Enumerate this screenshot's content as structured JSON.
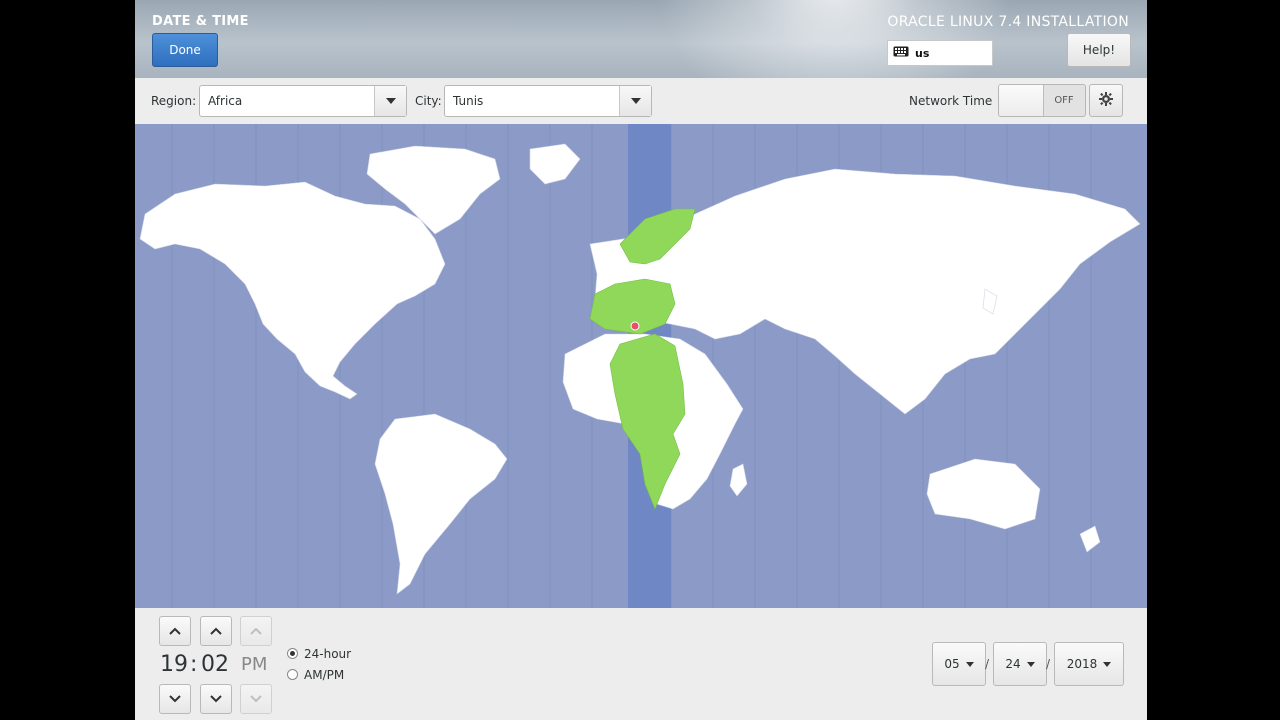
{
  "header": {
    "title": "DATE & TIME",
    "done_label": "Done",
    "product": "ORACLE LINUX 7.4 INSTALLATION",
    "keyboard_layout": "us",
    "help_label": "Help!"
  },
  "toolbar": {
    "region_label": "Region:",
    "region_value": "Africa",
    "city_label": "City:",
    "city_value": "Tunis",
    "network_time_label": "Network Time",
    "network_time_state": "OFF"
  },
  "map": {
    "ocean_color": "#8b9ac6",
    "land_color": "#ffffff",
    "highlight_color": "#8fd85a",
    "timezone_band_color": "#6f87c4",
    "marker_color": "#e8506a"
  },
  "time": {
    "hour": "19",
    "minute": "02",
    "ampm": "PM",
    "format_24h_label": "24-hour",
    "format_ampm_label": "AM/PM",
    "selected_format": "24-hour"
  },
  "date": {
    "month": "05",
    "day": "24",
    "year": "2018"
  }
}
